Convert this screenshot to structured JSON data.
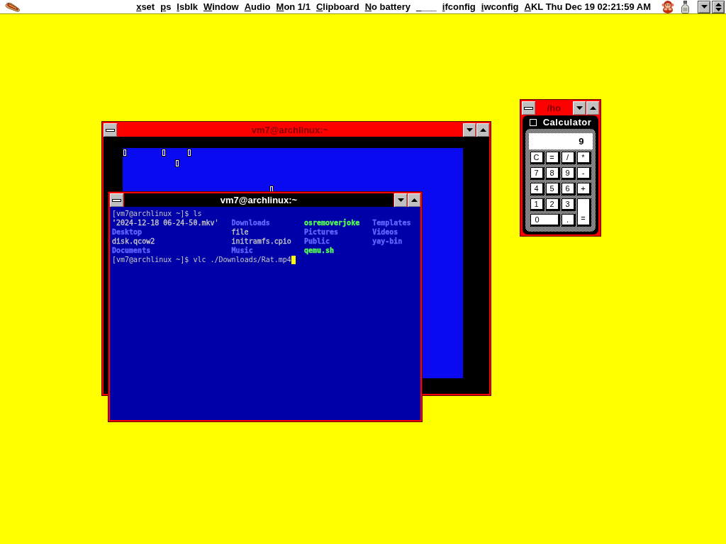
{
  "top_bar": {
    "menu": [
      "xset",
      "ps",
      "lsblk",
      "Window",
      "Audio",
      "Mon 1/1",
      "Clipboard",
      "No battery",
      "____",
      "ifconfig",
      "iwconfig",
      "AKL Thu Dec 19 02:21:59 AM"
    ]
  },
  "back_window": {
    "title": "vm7@archlinux:~",
    "active": false
  },
  "terminal_window": {
    "title": "vm7@archlinux:~",
    "active": true,
    "lines": [
      {
        "kind": "prompt",
        "prompt": "[vm7@archlinux ~]$",
        "command": "ls",
        "cursor": false
      },
      {
        "kind": "listing",
        "entries": [
          {
            "text": "'2024-12-18 06-24-50.mkv'",
            "kind": "file",
            "color": "#c8c8c8"
          },
          {
            "text": "Downloads",
            "kind": "dir",
            "color": "#6464ff"
          },
          {
            "text": "osremoverjoke",
            "kind": "exec",
            "color": "#54fc54"
          },
          {
            "text": "Templates",
            "kind": "dir",
            "color": "#6464ff"
          }
        ]
      },
      {
        "kind": "listing",
        "entries": [
          {
            "text": "Desktop",
            "kind": "dir",
            "color": "#6464ff"
          },
          {
            "text": "file",
            "kind": "file",
            "color": "#c8c8c8"
          },
          {
            "text": "Pictures",
            "kind": "dir",
            "color": "#6464ff"
          },
          {
            "text": "Videos",
            "kind": "dir",
            "color": "#6464ff"
          }
        ]
      },
      {
        "kind": "listing",
        "entries": [
          {
            "text": "disk.qcow2",
            "kind": "file",
            "color": "#c8c8c8"
          },
          {
            "text": "initramfs.cpio",
            "kind": "file",
            "color": "#c8c8c8"
          },
          {
            "text": "Public",
            "kind": "dir",
            "color": "#6464ff"
          },
          {
            "text": "yay-bin",
            "kind": "dir",
            "color": "#6464ff"
          }
        ]
      },
      {
        "kind": "listing",
        "entries": [
          {
            "text": "Documents",
            "kind": "dir",
            "color": "#6464ff"
          },
          {
            "text": "Music",
            "kind": "dir",
            "color": "#6464ff"
          },
          {
            "text": "qemu.sh",
            "kind": "exec",
            "color": "#54fc54"
          }
        ]
      },
      {
        "kind": "prompt",
        "prompt": "[vm7@archlinux ~]$",
        "command": "vlc ./Downloads/Rat.mp4",
        "cursor": true
      }
    ]
  },
  "calculator_window": {
    "title": "/ho",
    "active": false,
    "app_title": "Calculator",
    "display": "9",
    "keys": [
      {
        "label": "C",
        "kind": "normal"
      },
      {
        "label": "=",
        "kind": "normal"
      },
      {
        "label": "/",
        "kind": "normal"
      },
      {
        "label": "*",
        "kind": "normal"
      },
      {
        "label": "7",
        "kind": "normal"
      },
      {
        "label": "8",
        "kind": "normal"
      },
      {
        "label": "9",
        "kind": "normal"
      },
      {
        "label": "-",
        "kind": "normal"
      },
      {
        "label": "4",
        "kind": "normal"
      },
      {
        "label": "5",
        "kind": "normal"
      },
      {
        "label": "6",
        "kind": "normal"
      },
      {
        "label": "+",
        "kind": "normal"
      },
      {
        "label": "1",
        "kind": "normal"
      },
      {
        "label": "2",
        "kind": "normal"
      },
      {
        "label": "3",
        "kind": "normal"
      },
      {
        "label": "0",
        "kind": "wide"
      },
      {
        "label": ".",
        "kind": "normal"
      },
      {
        "label": "=",
        "kind": "tall"
      }
    ]
  }
}
